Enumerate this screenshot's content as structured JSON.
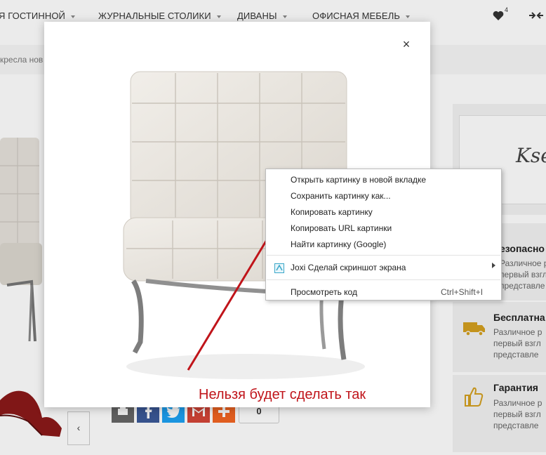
{
  "nav": {
    "items": [
      "Я ГОСТИННОЙ",
      "ЖУРНАЛЬНЫЕ СТОЛИКИ",
      "ДИВАНЫ",
      "ОФИСНАЯ МЕБЕЛЬ"
    ],
    "wishlist_count": "4"
  },
  "breadcrumb": "кресла нов",
  "sidebar": {
    "brand_logo": "Ksen",
    "features": [
      {
        "title": "езопасно",
        "text": [
          "Различное р",
          "первый взгл",
          "представле"
        ],
        "icon": "shield-icon"
      },
      {
        "title": "Бесплатна",
        "text": [
          "Различное р",
          "первый взгл",
          "представле"
        ],
        "icon": "truck-icon"
      },
      {
        "title": "Гарантия",
        "text": [
          "Различное р",
          "первый взгл",
          "представле"
        ],
        "icon": "thumbs-up-icon"
      }
    ]
  },
  "share": {
    "count": "0",
    "buttons": [
      "print-icon",
      "facebook-icon",
      "twitter-icon",
      "gmail-icon",
      "plus-icon"
    ]
  },
  "thumbnails": {
    "prev_label": "‹"
  },
  "modal": {
    "close_label": "×"
  },
  "context_menu": {
    "items": [
      "Открыть картинку в новой вкладке",
      "Сохранить картинку как...",
      "Копировать картинку",
      "Копировать URL картинки",
      "Найти картинку (Google)"
    ],
    "joxi_label": "Joxi Сделай скриншот экрана",
    "inspect_label": "Просмотреть код",
    "inspect_shortcut": "Ctrl+Shift+I"
  },
  "annotation": "Нельзя будет сделать так",
  "colors": {
    "annotation": "#c0141a",
    "icon_gold": "#d4a020",
    "facebook": "#3b5998",
    "twitter": "#1da1f2",
    "gmail": "#d44638"
  }
}
